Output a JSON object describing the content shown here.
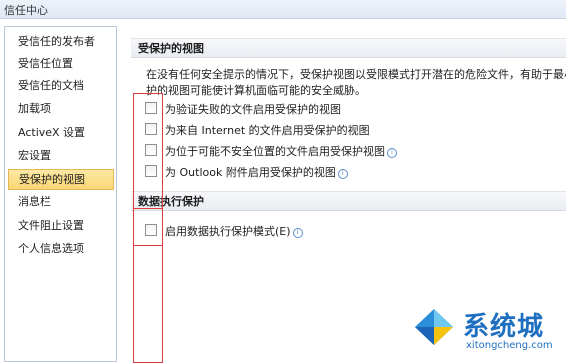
{
  "window": {
    "title": "信任中心"
  },
  "sidebar": {
    "items": [
      {
        "label": "受信任的发布者"
      },
      {
        "label": "受信任位置"
      },
      {
        "label": "受信任的文档"
      },
      {
        "label": "加载项"
      },
      {
        "label": "ActiveX 设置"
      },
      {
        "label": "宏设置"
      },
      {
        "label": "受保护的视图",
        "selected": true
      },
      {
        "label": "消息栏"
      },
      {
        "label": "文件阻止设置"
      },
      {
        "label": "个人信息选项"
      }
    ]
  },
  "protected_view": {
    "heading": "受保护的视图",
    "description": [
      "在没有任何安全提示的情况下，受保护视图以受限模式打开潜在的危险文件，有助于最小化对",
      "护的视图可能使计算机面临可能的安全威胁。"
    ],
    "options": [
      {
        "label": "为验证失败的文件启用受保护的视图",
        "checked": false,
        "info": false
      },
      {
        "label": "为来自 Internet 的文件启用受保护的视图",
        "checked": false,
        "info": false
      },
      {
        "label": "为位于可能不安全位置的文件启用受保护视图",
        "checked": false,
        "info": true
      },
      {
        "label": "为 Outlook 附件启用受保护的视图",
        "checked": false,
        "info": true
      }
    ]
  },
  "dep": {
    "heading": "数据执行保护",
    "options": [
      {
        "label": "启用数据执行保护模式(E)",
        "checked": false,
        "info": true
      }
    ]
  },
  "info_glyph": "i",
  "colors": {
    "highlight_box": "#e03c3c",
    "selected_bg": "#fad775",
    "watermark": "#1f6fc0"
  },
  "watermark": {
    "name": "系统城",
    "url": "xitongcheng.com"
  }
}
